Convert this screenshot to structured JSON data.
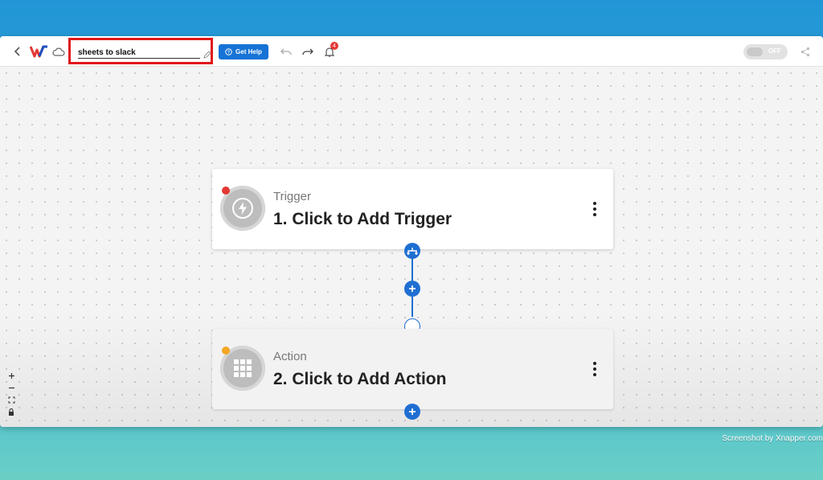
{
  "toolbar": {
    "back_icon": "chevron-left-icon",
    "logo_icon": "w-logo-icon",
    "cloud_icon": "cloud-icon",
    "workflow_name": "sheets to slack",
    "help_label": "Get Help",
    "undo_icon": "undo-icon",
    "redo_icon": "redo-icon",
    "notifications_count": "4",
    "toggle_label": "OFF",
    "share_icon": "share-icon"
  },
  "steps": [
    {
      "label": "Trigger",
      "title": "1. Click to Add Trigger",
      "status_color": "#e53935",
      "icon": "lightning-icon"
    },
    {
      "label": "Action",
      "title": "2. Click to Add Action",
      "status_color": "#f5a623",
      "icon": "grid-apps-icon"
    }
  ],
  "zoom_controls": [
    "zoom-in-icon",
    "zoom-out-icon",
    "fit-view-icon",
    "lock-icon"
  ],
  "colors": {
    "accent": "#1f6fd2",
    "help_button": "#1673d6",
    "highlight_box": "#e0181b"
  },
  "watermark": "Screenshot by Xnapper.com"
}
